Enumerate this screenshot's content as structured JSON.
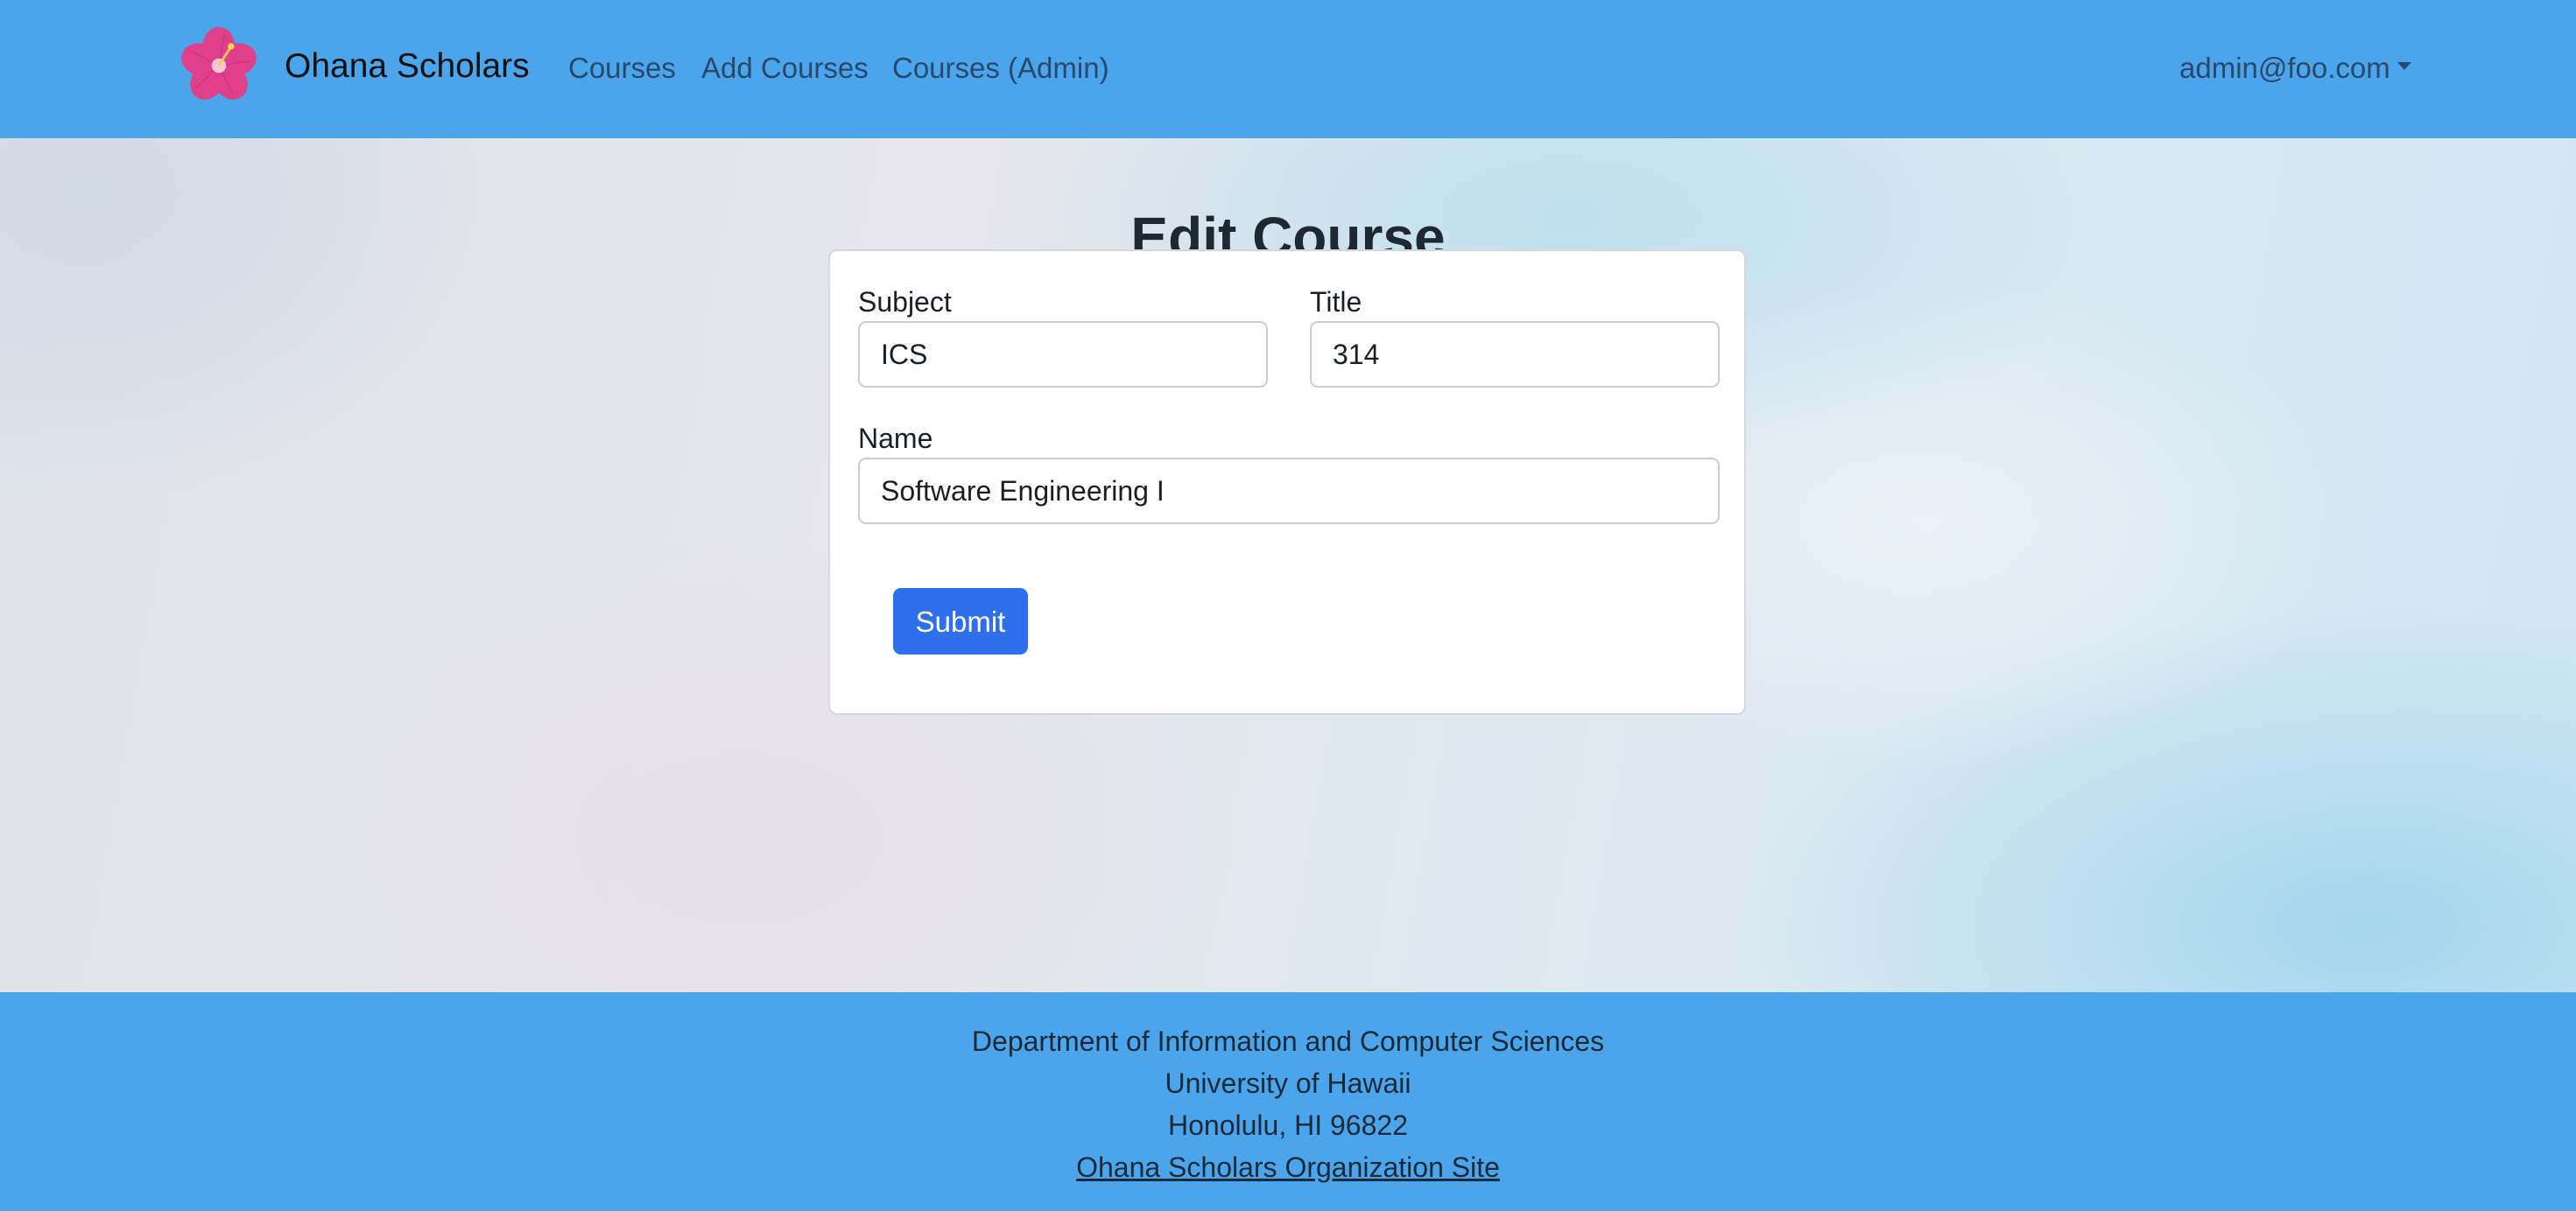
{
  "navbar": {
    "brand": "Ohana Scholars",
    "links": [
      "Courses",
      "Add Courses",
      "Courses (Admin)"
    ],
    "user": "admin@foo.com",
    "logo_icon": "hibiscus-flower-icon"
  },
  "page": {
    "title": "Edit Course"
  },
  "form": {
    "subject_label": "Subject",
    "subject_value": "ICS",
    "title_label": "Title",
    "title_value": "314",
    "name_label": "Name",
    "name_value": "Software Engineering I",
    "submit_label": "Submit"
  },
  "footer": {
    "line1": "Department of Information and Computer Sciences",
    "line2": "University of Hawaii",
    "line3": "Honolulu, HI 96822",
    "link": "Ohana Scholars Organization Site"
  },
  "colors": {
    "navbar_bg": "#4ba5ec",
    "footer_bg": "#4ba5ec",
    "button_bg": "#2f6fec",
    "logo_petal": "#e0408a"
  }
}
